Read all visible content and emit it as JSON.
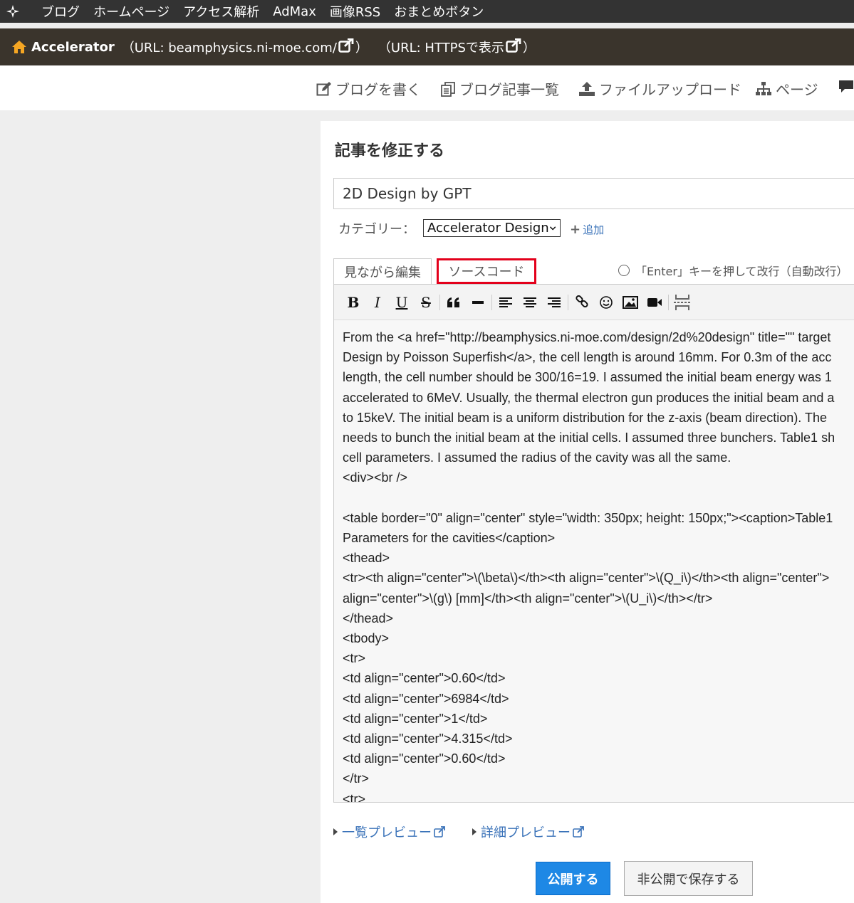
{
  "topnav": {
    "items": [
      "ブログ",
      "ホームページ",
      "アクセス解析",
      "AdMax",
      "画像RSS",
      "おまとめボタン"
    ]
  },
  "blogbar": {
    "name": "Accelerator",
    "url_text": "（URL: beamphysics.ni-moe.com/",
    "url_close": "）",
    "https_text": "（URL: HTTPSで表示"
  },
  "actions": {
    "write": "ブログを書く",
    "list": "ブログ記事一覧",
    "upload": "ファイルアップロード",
    "pages": "ページ"
  },
  "editor": {
    "heading": "記事を修正する",
    "title_value": "2D Design by GPT",
    "category_label": "カテゴリー：",
    "category_value": "Accelerator Design",
    "add_label": "追加",
    "tab_visual": "見ながら編集",
    "tab_source": "ソースコード",
    "enter_option": "「Enter」キーを押して改行（自動改行）",
    "source_lines": [
      "From the <a href=\"http://beamphysics.ni-moe.com/design/2d%20design\" title=\"\" target",
      "Design by Poisson Superfish</a>, the cell length is around 16mm. For 0.3m of the acc",
      "length, the cell number should be 300/16=19. I assumed the initial beam energy was 1",
      "accelerated to 6MeV. Usually, the thermal electron gun produces the initial beam and a",
      "to 15keV. The initial beam is a uniform distribution for the z-axis (beam direction). The",
      "needs to bunch the initial beam at the initial cells. I assumed three bunchers. Table1 sh",
      "cell parameters. I assumed the radius of the cavity was all the same.",
      "<div><br />",
      "",
      "<table border=\"0\" align=\"center\" style=\"width: 350px; height: 150px;\"><caption>Table1",
      "Parameters for the cavities</caption>",
      "<thead>",
      "<tr><th align=\"center\">\\(\\beta\\)</th><th align=\"center\">\\(Q_i\\)</th><th align=\"center\">",
      "align=\"center\">\\(g\\) [mm]</th><th align=\"center\">\\(U_i\\)</th></tr>",
      "</thead>",
      "<tbody>",
      "<tr>",
      "<td align=\"center\">0.60</td>",
      "<td align=\"center\">6984</td>",
      "<td align=\"center\">1</td>",
      "<td align=\"center\">4.315</td>",
      "<td align=\"center\">0.60</td>",
      "</tr>",
      "<tr>"
    ]
  },
  "preview": {
    "list": "一覧プレビュー",
    "detail": "詳細プレビュー"
  },
  "buttons": {
    "publish": "公開する",
    "save_private": "非公開で保存する"
  }
}
